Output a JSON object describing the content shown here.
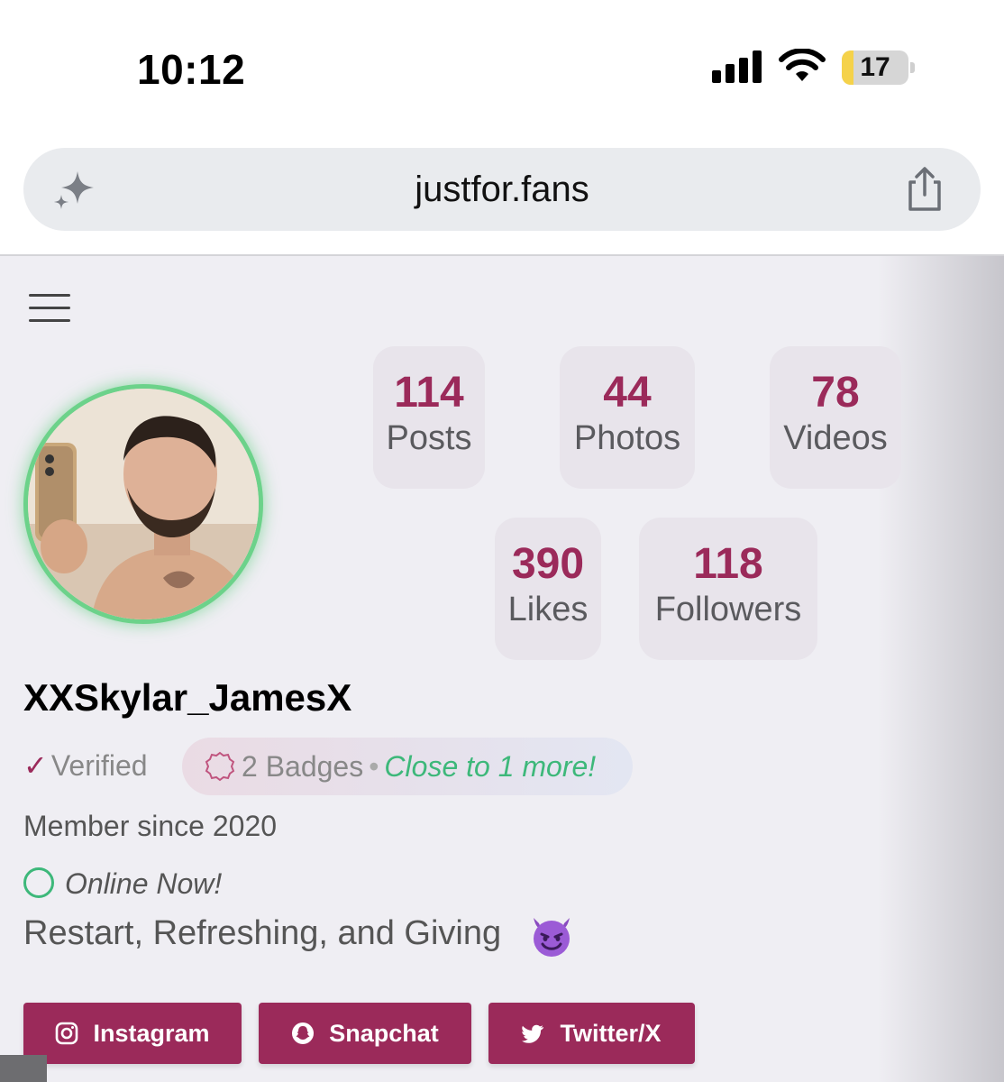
{
  "status_bar": {
    "time": "10:12",
    "battery_level": "17",
    "battery_fraction": 0.17
  },
  "browser": {
    "url": "justfor.fans"
  },
  "profile": {
    "stats": [
      {
        "value": "114",
        "label": "Posts"
      },
      {
        "value": "44",
        "label": "Photos"
      },
      {
        "value": "78",
        "label": "Videos"
      },
      {
        "value": "390",
        "label": "Likes"
      },
      {
        "value": "118",
        "label": "Followers"
      }
    ],
    "username": "XXSkylar_JamesX",
    "verified_check": "✓",
    "verified_label": "Verified",
    "badges_count": "2 Badges",
    "badges_separator": "•",
    "badges_progress": "Close to 1 more!",
    "member_since": "Member since 2020",
    "online_status": "Online Now!",
    "bio": "Restart, Refreshing, and Giving"
  },
  "social_links": [
    {
      "label": "Instagram",
      "icon": "instagram-icon"
    },
    {
      "label": "Snapchat",
      "icon": "snapchat-icon"
    },
    {
      "label": "Twitter/X",
      "icon": "twitter-icon"
    }
  ],
  "colors": {
    "accent": "#9b2a5a",
    "online_green": "#3db87a",
    "avatar_ring": "#6cd28a",
    "page_background": "#efeef3"
  }
}
